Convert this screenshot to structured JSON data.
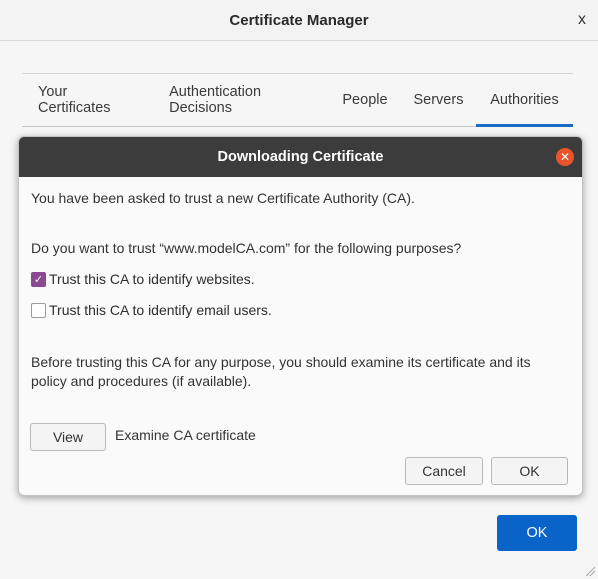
{
  "window": {
    "title": "Certificate Manager",
    "close_symbol": "x",
    "ok_label": "OK"
  },
  "tabs": [
    {
      "label": "Your Certificates",
      "active": false
    },
    {
      "label": "Authentication Decisions",
      "active": false
    },
    {
      "label": "People",
      "active": false
    },
    {
      "label": "Servers",
      "active": false
    },
    {
      "label": "Authorities",
      "active": true
    }
  ],
  "dialog": {
    "title": "Downloading Certificate",
    "intro": "You have been asked to trust a new Certificate Authority (CA).",
    "question": "Do you want to trust “www.modelCA.com” for the following purposes?",
    "options": [
      {
        "label": "Trust this CA to identify websites.",
        "checked": true
      },
      {
        "label": "Trust this CA to identify email users.",
        "checked": false
      }
    ],
    "advice": "Before trusting this CA for any purpose, you should examine its certificate and its policy and procedures (if available).",
    "view_label": "View",
    "view_desc": "Examine CA certificate",
    "cancel_label": "Cancel",
    "ok_label": "OK"
  },
  "colors": {
    "accent": "#0a63c9",
    "dialog_header": "#3c3c3c",
    "close_button": "#e9542a",
    "checkbox_checked": "#8b4a8f"
  }
}
